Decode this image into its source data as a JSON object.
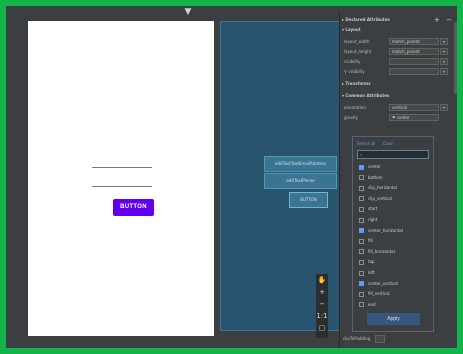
{
  "canvas": {
    "pin_icon": "pin-icon",
    "button_label": "BUTTON"
  },
  "blueprint": {
    "rows": [
      {
        "label": "editTextTextEmailAddress"
      },
      {
        "label": "editTextPhone"
      },
      {
        "label": "BUTTON"
      }
    ]
  },
  "toolbar": {
    "icons": [
      "hand-icon",
      "zoom-in-icon",
      "zoom-out-icon",
      "ratio-label",
      "fit-icon"
    ],
    "ratio_text": "1:1"
  },
  "panel": {
    "declared_title": "Declared Attributes",
    "layout_title": "Layout",
    "rows": [
      {
        "key": "layout_width",
        "value": "match_parent"
      },
      {
        "key": "layout_height",
        "value": "match_parent"
      },
      {
        "key": "visibility",
        "value": ""
      },
      {
        "key": "visibility",
        "value": ""
      }
    ],
    "transforms_title": "Transforms",
    "common_title": "Common Attributes",
    "orientation": {
      "key": "orientation",
      "value": "vertical"
    },
    "gravity": {
      "key": "gravity",
      "value": "center"
    }
  },
  "popup": {
    "select_all": "Select all",
    "clear": "Clear",
    "flags": [
      {
        "label": "center",
        "checked": true
      },
      {
        "label": "bottom",
        "checked": false
      },
      {
        "label": "clip_horizontal",
        "checked": false
      },
      {
        "label": "clip_vertical",
        "checked": false
      },
      {
        "label": "start",
        "checked": false
      },
      {
        "label": "right",
        "checked": false
      },
      {
        "label": "center_horizontal",
        "checked": true
      },
      {
        "label": "fill",
        "checked": false
      },
      {
        "label": "fill_horizontal",
        "checked": false
      },
      {
        "label": "top",
        "checked": false
      },
      {
        "label": "left",
        "checked": false
      },
      {
        "label": "center_vertical",
        "checked": true
      },
      {
        "label": "fill_vertical",
        "checked": false
      },
      {
        "label": "end",
        "checked": false
      }
    ],
    "apply_label": "Apply"
  },
  "footer": {
    "clip_label": "clipToPadding"
  }
}
